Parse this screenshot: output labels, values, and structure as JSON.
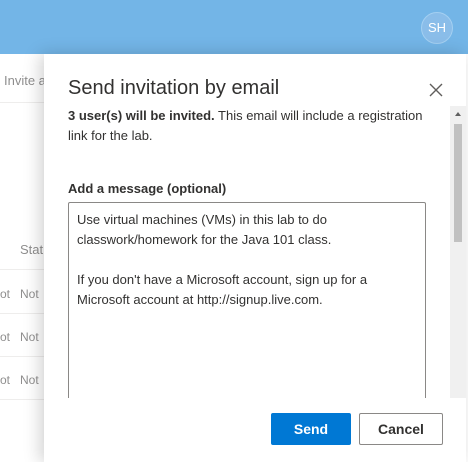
{
  "header": {
    "avatar_initials": "SH",
    "accent": "#0078d4"
  },
  "background": {
    "invite_text": "Invite a",
    "status_header": "Stat",
    "rows": [
      {
        "col_a": "ot",
        "col_b": "Not"
      },
      {
        "col_a": "ot",
        "col_b": "Not"
      },
      {
        "col_a": "ot",
        "col_b": "Not"
      }
    ]
  },
  "dialog": {
    "title": "Send invitation by email",
    "close_icon": "close-icon",
    "intro_bold": "3 user(s) will be invited.",
    "intro_rest": " This email will include a registration link for the lab.",
    "message_label": "Add a message (optional)",
    "message_line1": "Use virtual machines (VMs) in this lab to do classwork/homework for the Java 101 class.",
    "message_line2": "If you don't have a Microsoft account, sign up for a Microsoft account at http://signup.live.com.",
    "send_label": "Send",
    "cancel_label": "Cancel"
  }
}
